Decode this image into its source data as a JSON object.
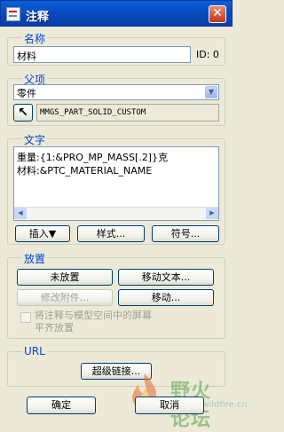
{
  "window": {
    "title": "注释",
    "close_glyph": "✕"
  },
  "name_group": {
    "label": "名称",
    "value": "材料",
    "id_text": "ID: 0"
  },
  "parent_group": {
    "label": "父项",
    "selected": "零件",
    "picker_glyph": "↖",
    "model_name": "MMGS_PART_SOLID_CUSTOM"
  },
  "text_group": {
    "label": "文字",
    "lines": [
      "重量:{1:&PRO_MP_MASS[.2]}克",
      "材料:&PTC_MATERIAL_NAME"
    ],
    "insert_label": "插入▼",
    "style_label": "样式...",
    "symbol_label": "符号..."
  },
  "place_group": {
    "label": "放置",
    "unplaced_label": "未放置",
    "move_text_label": "移动文本...",
    "modify_attach_label": "修改附件...",
    "move_label": "移动...",
    "align_checkbox_line1": "将注释与模型空间中的屏幕",
    "align_checkbox_line2": "平齐放置"
  },
  "url_group": {
    "label": "URL",
    "hyperlink_label": "超级链接..."
  },
  "footer": {
    "ok_label": "确定",
    "cancel_label": "取消"
  },
  "watermark": {
    "text": "野火论坛",
    "url": "www.proewildfire.cn"
  },
  "colors": {
    "group_label": "#0046d5",
    "titlebar": "#0a5fd8",
    "disabled_text": "#a0a094"
  }
}
